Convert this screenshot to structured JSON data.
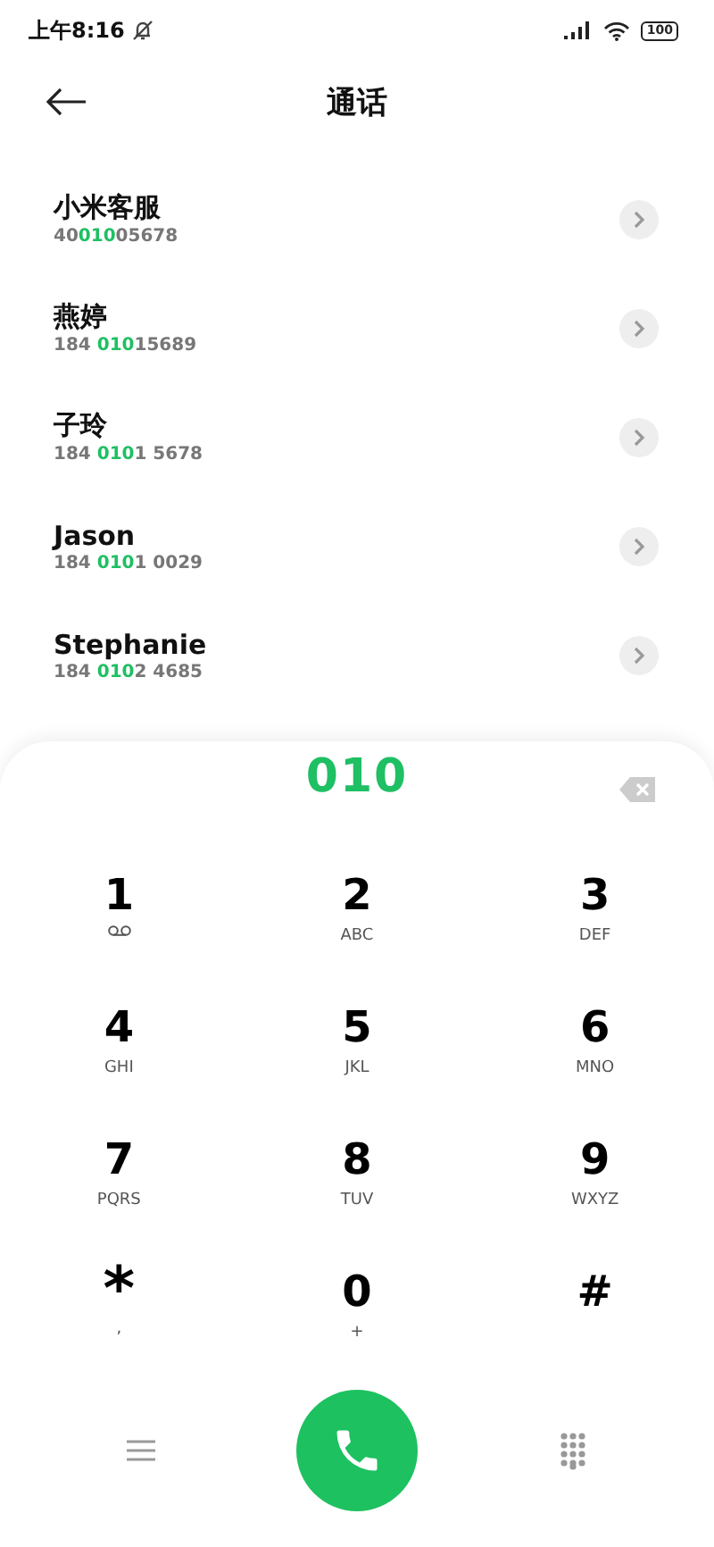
{
  "status_bar": {
    "time": "上午8:16",
    "battery": "100"
  },
  "header": {
    "title": "通话"
  },
  "contacts": [
    {
      "name": "小米客服",
      "number": [
        {
          "text": "40",
          "highlight": false
        },
        {
          "text": "010",
          "highlight": true
        },
        {
          "text": "05678",
          "highlight": false
        }
      ]
    },
    {
      "name": "燕婷",
      "number": [
        {
          "text": "184 ",
          "highlight": false
        },
        {
          "text": "010",
          "highlight": true
        },
        {
          "text": "15689",
          "highlight": false
        }
      ]
    },
    {
      "name": "子玲",
      "number": [
        {
          "text": "184 ",
          "highlight": false
        },
        {
          "text": "010",
          "highlight": true
        },
        {
          "text": "1 5678",
          "highlight": false
        }
      ]
    },
    {
      "name": "Jason",
      "number": [
        {
          "text": "184 ",
          "highlight": false
        },
        {
          "text": "010",
          "highlight": true
        },
        {
          "text": "1 0029",
          "highlight": false
        }
      ]
    },
    {
      "name": "Stephanie",
      "number": [
        {
          "text": "184 ",
          "highlight": false
        },
        {
          "text": "010",
          "highlight": true
        },
        {
          "text": "2 4685",
          "highlight": false
        }
      ]
    }
  ],
  "dialer": {
    "entered": "010",
    "keys": [
      {
        "digit": "1",
        "kind": "voicemail"
      },
      {
        "digit": "2",
        "kind": "letters",
        "sub": "ABC"
      },
      {
        "digit": "3",
        "kind": "letters",
        "sub": "DEF"
      },
      {
        "digit": "4",
        "kind": "letters",
        "sub": "GHI"
      },
      {
        "digit": "5",
        "kind": "letters",
        "sub": "JKL"
      },
      {
        "digit": "6",
        "kind": "letters",
        "sub": "MNO"
      },
      {
        "digit": "7",
        "kind": "letters",
        "sub": "PQRS"
      },
      {
        "digit": "8",
        "kind": "letters",
        "sub": "TUV"
      },
      {
        "digit": "9",
        "kind": "letters",
        "sub": "WXYZ"
      },
      {
        "digit": "*",
        "kind": "letters",
        "sub": ","
      },
      {
        "digit": "0",
        "kind": "letters",
        "sub": "+"
      },
      {
        "digit": "#",
        "kind": "plain"
      }
    ]
  }
}
